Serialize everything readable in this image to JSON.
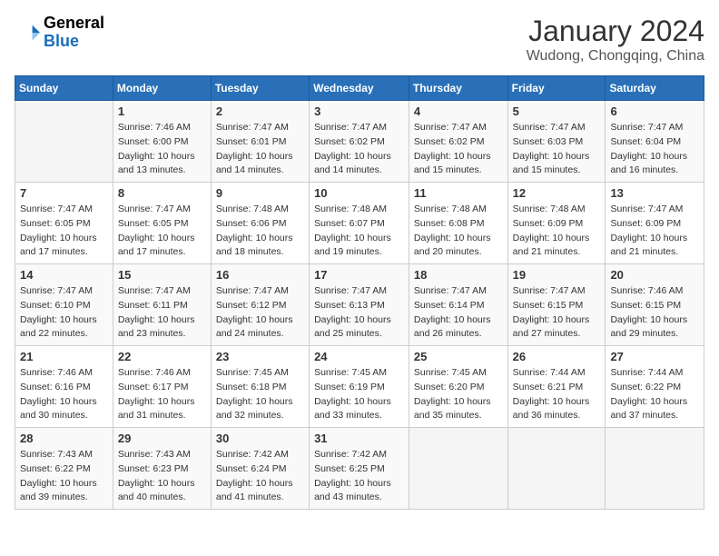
{
  "header": {
    "logo_general": "General",
    "logo_blue": "Blue",
    "month_title": "January 2024",
    "location": "Wudong, Chongqing, China"
  },
  "days_of_week": [
    "Sunday",
    "Monday",
    "Tuesday",
    "Wednesday",
    "Thursday",
    "Friday",
    "Saturday"
  ],
  "weeks": [
    [
      {
        "day": "",
        "info": ""
      },
      {
        "day": "1",
        "info": "Sunrise: 7:46 AM\nSunset: 6:00 PM\nDaylight: 10 hours\nand 13 minutes."
      },
      {
        "day": "2",
        "info": "Sunrise: 7:47 AM\nSunset: 6:01 PM\nDaylight: 10 hours\nand 14 minutes."
      },
      {
        "day": "3",
        "info": "Sunrise: 7:47 AM\nSunset: 6:02 PM\nDaylight: 10 hours\nand 14 minutes."
      },
      {
        "day": "4",
        "info": "Sunrise: 7:47 AM\nSunset: 6:02 PM\nDaylight: 10 hours\nand 15 minutes."
      },
      {
        "day": "5",
        "info": "Sunrise: 7:47 AM\nSunset: 6:03 PM\nDaylight: 10 hours\nand 15 minutes."
      },
      {
        "day": "6",
        "info": "Sunrise: 7:47 AM\nSunset: 6:04 PM\nDaylight: 10 hours\nand 16 minutes."
      }
    ],
    [
      {
        "day": "7",
        "info": "Sunrise: 7:47 AM\nSunset: 6:05 PM\nDaylight: 10 hours\nand 17 minutes."
      },
      {
        "day": "8",
        "info": "Sunrise: 7:47 AM\nSunset: 6:05 PM\nDaylight: 10 hours\nand 17 minutes."
      },
      {
        "day": "9",
        "info": "Sunrise: 7:48 AM\nSunset: 6:06 PM\nDaylight: 10 hours\nand 18 minutes."
      },
      {
        "day": "10",
        "info": "Sunrise: 7:48 AM\nSunset: 6:07 PM\nDaylight: 10 hours\nand 19 minutes."
      },
      {
        "day": "11",
        "info": "Sunrise: 7:48 AM\nSunset: 6:08 PM\nDaylight: 10 hours\nand 20 minutes."
      },
      {
        "day": "12",
        "info": "Sunrise: 7:48 AM\nSunset: 6:09 PM\nDaylight: 10 hours\nand 21 minutes."
      },
      {
        "day": "13",
        "info": "Sunrise: 7:47 AM\nSunset: 6:09 PM\nDaylight: 10 hours\nand 21 minutes."
      }
    ],
    [
      {
        "day": "14",
        "info": "Sunrise: 7:47 AM\nSunset: 6:10 PM\nDaylight: 10 hours\nand 22 minutes."
      },
      {
        "day": "15",
        "info": "Sunrise: 7:47 AM\nSunset: 6:11 PM\nDaylight: 10 hours\nand 23 minutes."
      },
      {
        "day": "16",
        "info": "Sunrise: 7:47 AM\nSunset: 6:12 PM\nDaylight: 10 hours\nand 24 minutes."
      },
      {
        "day": "17",
        "info": "Sunrise: 7:47 AM\nSunset: 6:13 PM\nDaylight: 10 hours\nand 25 minutes."
      },
      {
        "day": "18",
        "info": "Sunrise: 7:47 AM\nSunset: 6:14 PM\nDaylight: 10 hours\nand 26 minutes."
      },
      {
        "day": "19",
        "info": "Sunrise: 7:47 AM\nSunset: 6:15 PM\nDaylight: 10 hours\nand 27 minutes."
      },
      {
        "day": "20",
        "info": "Sunrise: 7:46 AM\nSunset: 6:15 PM\nDaylight: 10 hours\nand 29 minutes."
      }
    ],
    [
      {
        "day": "21",
        "info": "Sunrise: 7:46 AM\nSunset: 6:16 PM\nDaylight: 10 hours\nand 30 minutes."
      },
      {
        "day": "22",
        "info": "Sunrise: 7:46 AM\nSunset: 6:17 PM\nDaylight: 10 hours\nand 31 minutes."
      },
      {
        "day": "23",
        "info": "Sunrise: 7:45 AM\nSunset: 6:18 PM\nDaylight: 10 hours\nand 32 minutes."
      },
      {
        "day": "24",
        "info": "Sunrise: 7:45 AM\nSunset: 6:19 PM\nDaylight: 10 hours\nand 33 minutes."
      },
      {
        "day": "25",
        "info": "Sunrise: 7:45 AM\nSunset: 6:20 PM\nDaylight: 10 hours\nand 35 minutes."
      },
      {
        "day": "26",
        "info": "Sunrise: 7:44 AM\nSunset: 6:21 PM\nDaylight: 10 hours\nand 36 minutes."
      },
      {
        "day": "27",
        "info": "Sunrise: 7:44 AM\nSunset: 6:22 PM\nDaylight: 10 hours\nand 37 minutes."
      }
    ],
    [
      {
        "day": "28",
        "info": "Sunrise: 7:43 AM\nSunset: 6:22 PM\nDaylight: 10 hours\nand 39 minutes."
      },
      {
        "day": "29",
        "info": "Sunrise: 7:43 AM\nSunset: 6:23 PM\nDaylight: 10 hours\nand 40 minutes."
      },
      {
        "day": "30",
        "info": "Sunrise: 7:42 AM\nSunset: 6:24 PM\nDaylight: 10 hours\nand 41 minutes."
      },
      {
        "day": "31",
        "info": "Sunrise: 7:42 AM\nSunset: 6:25 PM\nDaylight: 10 hours\nand 43 minutes."
      },
      {
        "day": "",
        "info": ""
      },
      {
        "day": "",
        "info": ""
      },
      {
        "day": "",
        "info": ""
      }
    ]
  ]
}
